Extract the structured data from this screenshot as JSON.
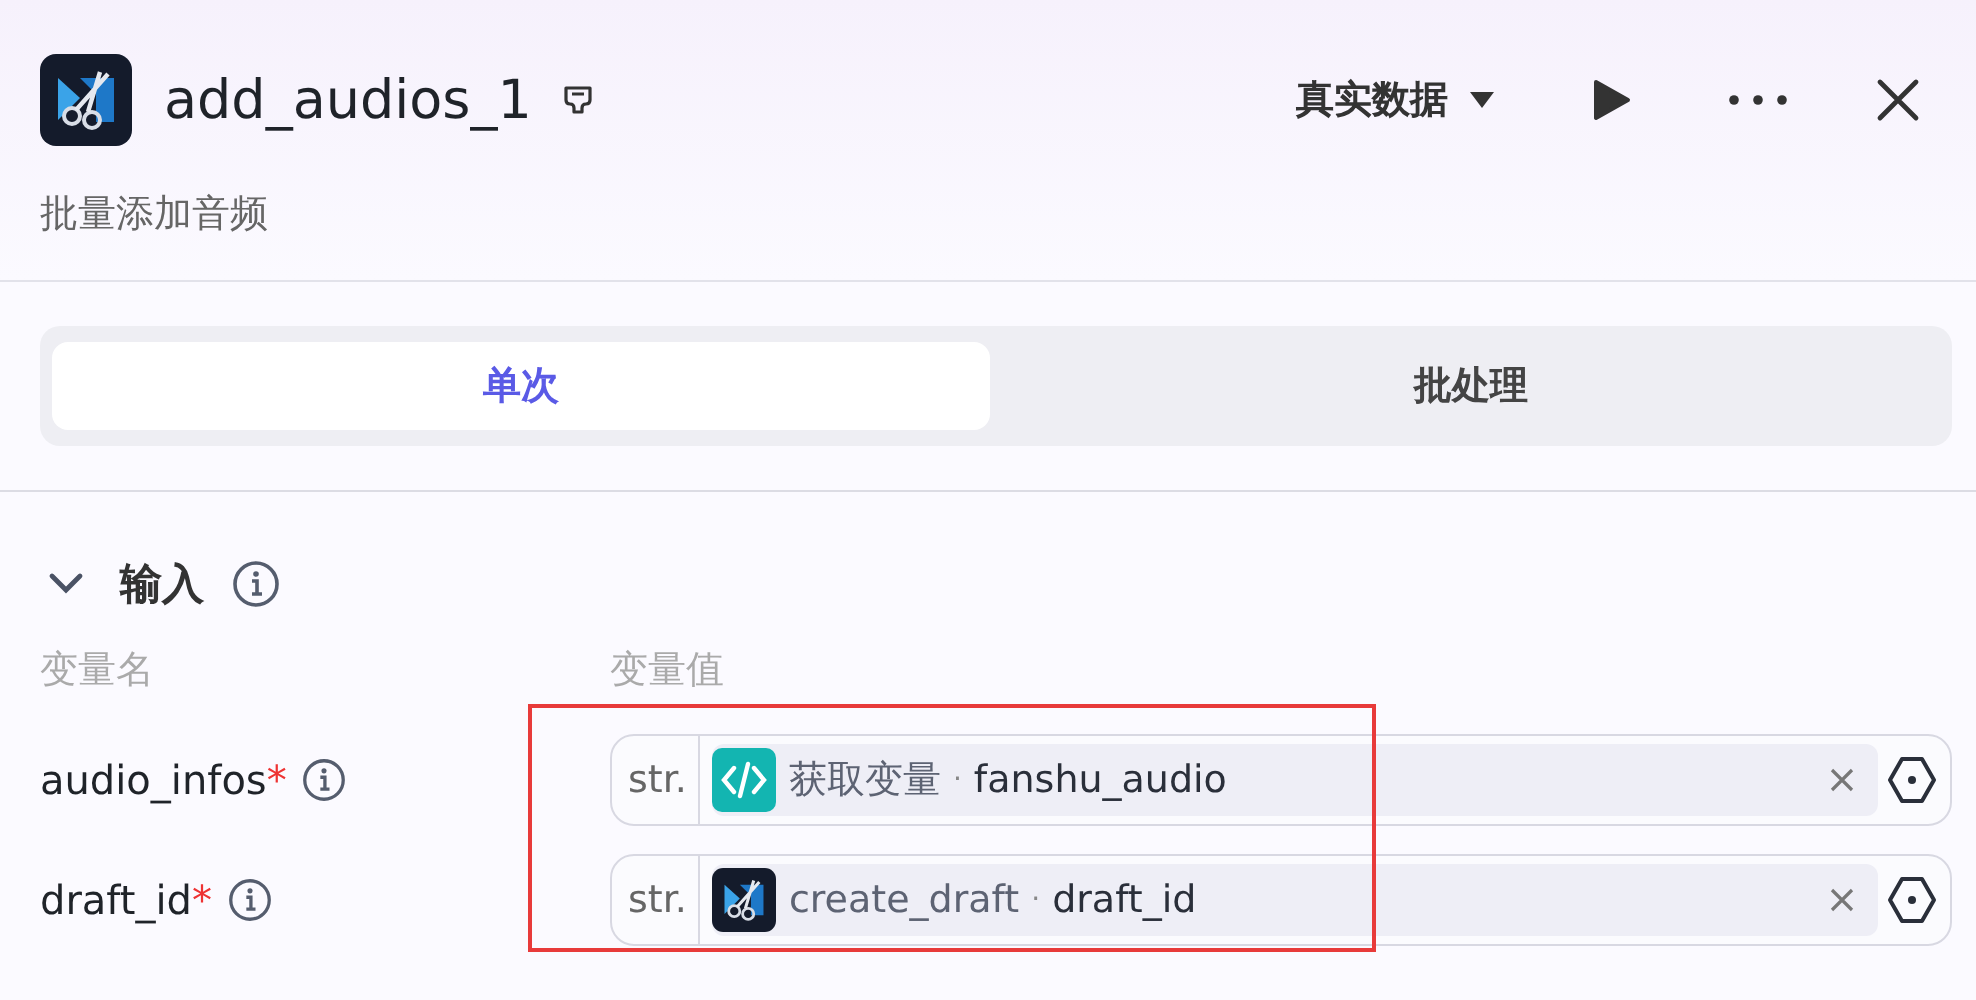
{
  "node": {
    "title": "add_audios_1",
    "description": "批量添加音频"
  },
  "data_mode": {
    "label": "真实数据"
  },
  "tabs": [
    {
      "label": "单次",
      "selected": true
    },
    {
      "label": "批处理",
      "selected": false
    }
  ],
  "input_section": {
    "title": "输入",
    "expanded": true,
    "columns": [
      "变量名",
      "变量值"
    ],
    "params": [
      {
        "name": "audio_infos",
        "required_mark": "*",
        "type": "str.",
        "kind": "code",
        "source": "获取变量",
        "separator": "·",
        "variable": "fanshu_audio"
      },
      {
        "name": "draft_id",
        "required_mark": "*",
        "type": "str.",
        "kind": "app",
        "source": "create_draft",
        "separator": "·",
        "variable": "draft_id"
      }
    ]
  }
}
